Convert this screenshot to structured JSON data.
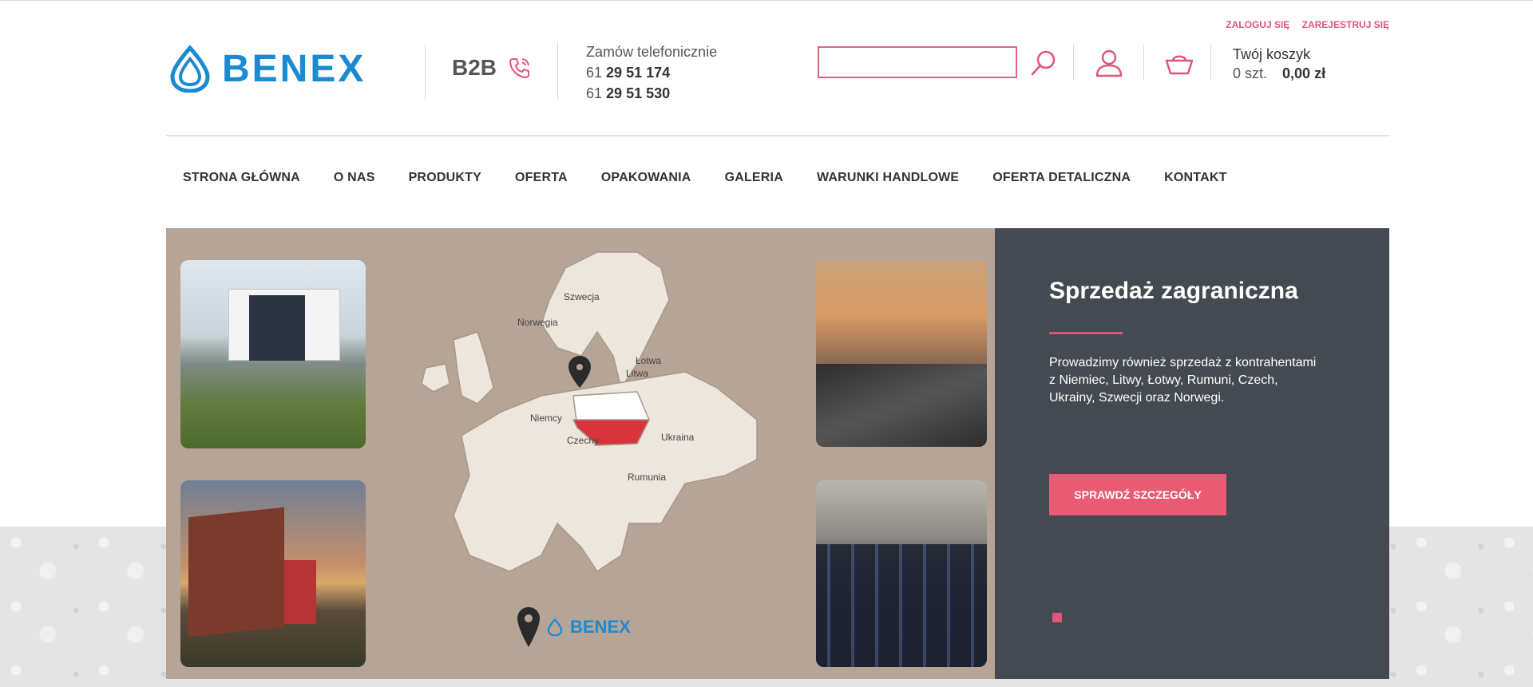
{
  "brand": {
    "logo_text": "BENEX",
    "b2b_label": "B2B"
  },
  "phones": {
    "label": "Zamów telefonicznie",
    "numbers": [
      {
        "prefix": "61",
        "main": "29 51 174"
      },
      {
        "prefix": "61",
        "main": "29 51 530"
      }
    ]
  },
  "search": {
    "placeholder": "",
    "value": ""
  },
  "auth": {
    "login": "ZALOGUJ SIĘ",
    "register": "ZAREJESTRUJ SIĘ"
  },
  "cart": {
    "title": "Twój koszyk",
    "count": "0 szt.",
    "total": "0,00 zł"
  },
  "nav": [
    "STRONA GŁÓWNA",
    "O NAS",
    "PRODUKTY",
    "OFERTA",
    "OPAKOWANIA",
    "GALERIA",
    "WARUNKI HANDLOWE",
    "OFERTA DETALICZNA",
    "KONTAKT"
  ],
  "hero": {
    "title": "Sprzedaż zagraniczna",
    "text": "Prowadzimy również sprzedaż z kontrahentami z Niemiec, Litwy, Łotwy, Rumuni, Czech, Ukrainy, Szwecji oraz Norwegi.",
    "cta": "SPRAWDŹ SZCZEGÓŁY",
    "map_labels": {
      "szwecja": "Szwecja",
      "norwegia": "Norwegia",
      "lotwa": "Łotwa",
      "litwa": "Litwa",
      "niemcy": "Niemcy",
      "czechy": "Czechy",
      "ukraina": "Ukraina",
      "rumunia": "Rumunia"
    },
    "map_brand": "BENEX"
  },
  "colors": {
    "accent": "#e0557a",
    "brand_blue": "#1a8ad1",
    "hero_dark": "#444a51",
    "hero_map_bg": "#b6a597"
  }
}
